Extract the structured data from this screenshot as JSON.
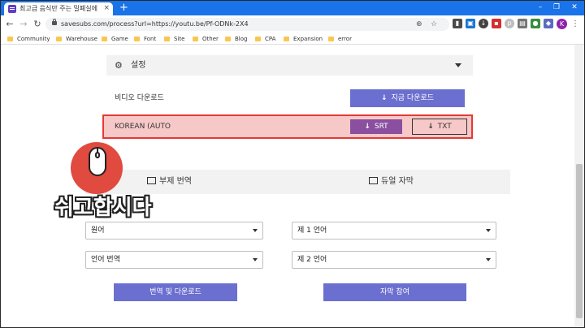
{
  "browser": {
    "tab_title": "최고급 음식만 주는 밀폐실에서",
    "tab_close": "×",
    "new_tab": "+",
    "url": "savesubs.com/process?url=https://youtu.be/Pf-ODNk-2X4",
    "profile_initial": "K",
    "window_controls": {
      "minimize": "–",
      "maximize": "❐",
      "close": "✕"
    },
    "bookmarks": [
      "Community",
      "Warehouse",
      "Game",
      "Font",
      "Site",
      "Other",
      "Blog",
      "CPA",
      "Expansion",
      "error"
    ]
  },
  "settings": {
    "label": "설정"
  },
  "video_download": {
    "label": "비디오 다운로드",
    "button": "지금 다운로드"
  },
  "subtitle_row": {
    "label": "KOREAN (AUTO",
    "srt_button": "SRT",
    "txt_button": "TXT"
  },
  "subtitle_tabs": {
    "sub_translate": "부제 번역",
    "dual_sub": "듀얼 자막"
  },
  "selects": {
    "original": "원어",
    "translate_lang": "언어 번역",
    "lang1": "제 1 언어",
    "lang2": "제 2 언어"
  },
  "actions": {
    "translate_download": "번역 및 다운로드",
    "join_subs": "자막 참여"
  },
  "overlay": {
    "text": "쉬고합시다"
  },
  "colors": {
    "accent": "#6b6fcf",
    "srt": "#8a4f9e",
    "highlight_border": "#e53935",
    "chrome_blue": "#1a73e8"
  }
}
